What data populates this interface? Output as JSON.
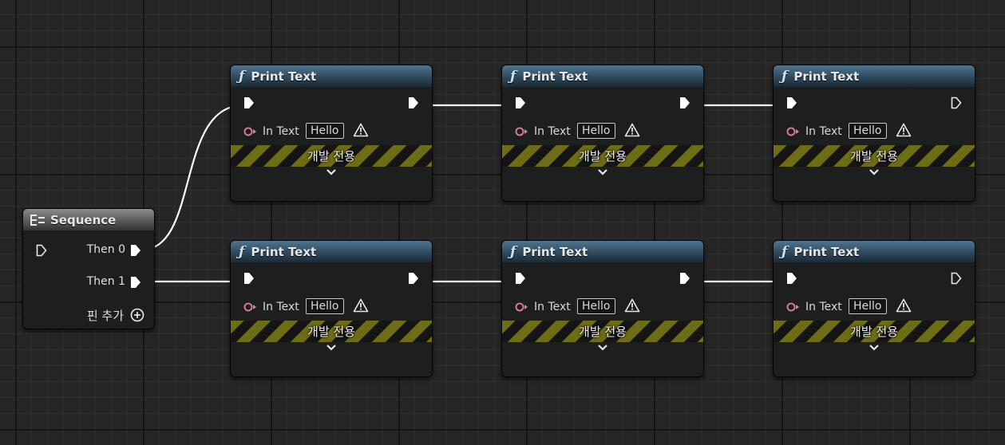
{
  "sequence": {
    "title": "Sequence",
    "pins": [
      "Then 0",
      "Then 1"
    ],
    "add_pin": "핀 추가"
  },
  "print_nodes": [
    {
      "title": "Print Text",
      "input_label": "In Text",
      "input_value": "Hello",
      "dev_label": "개발 전용"
    },
    {
      "title": "Print Text",
      "input_label": "In Text",
      "input_value": "Hello",
      "dev_label": "개발 전용"
    },
    {
      "title": "Print Text",
      "input_label": "In Text",
      "input_value": "Hello",
      "dev_label": "개발 전용"
    },
    {
      "title": "Print Text",
      "input_label": "In Text",
      "input_value": "Hello",
      "dev_label": "개발 전용"
    },
    {
      "title": "Print Text",
      "input_label": "In Text",
      "input_value": "Hello",
      "dev_label": "개발 전용"
    },
    {
      "title": "Print Text",
      "input_label": "In Text",
      "input_value": "Hello",
      "dev_label": "개발 전용"
    }
  ],
  "colors": {
    "function_header": "#3b5a70",
    "exec_wire": "#ffffff",
    "text_pin": "#e27fa0",
    "dev_stripe": "#6d6d15"
  },
  "icons": {
    "function": "function-icon",
    "sequence": "sequence-icon",
    "warning": "warning-icon",
    "chevron": "chevron-down-icon",
    "add": "add-pin-icon"
  }
}
